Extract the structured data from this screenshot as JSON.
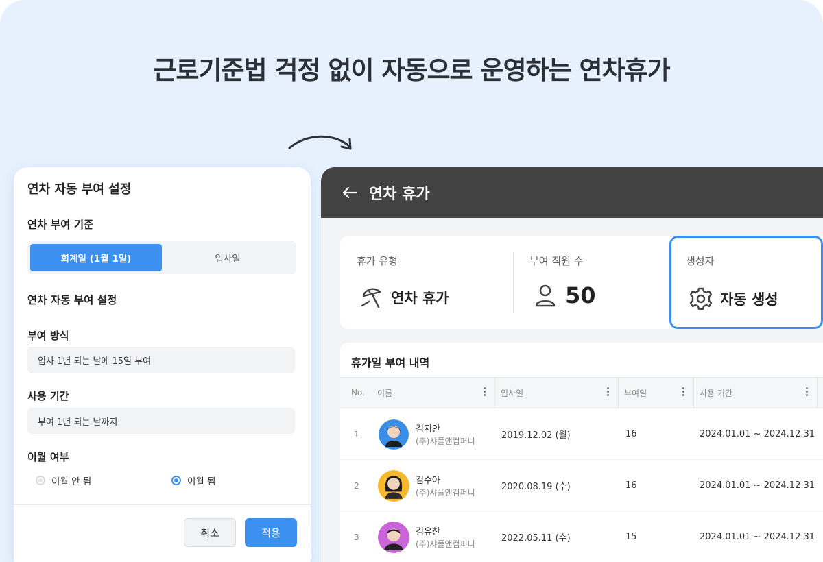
{
  "headline": "근로기준법 걱정 없이 자동으로 운영하는 연차휴가",
  "modal": {
    "title": "연차 자동 부여 설정",
    "basis_label": "연차 부여 기준",
    "basis_options": [
      "회계일 (1월 1일)",
      "입사일"
    ],
    "basis_selected": "회계일 (1월 1일)",
    "auto_label": "연차 자동 부여 설정",
    "method_label": "부여 방식",
    "method_value": "입사 1년 되는 날에 15일 부여",
    "period_label": "사용 기간",
    "period_value": "부여 1년 되는 날까지",
    "carry_label": "이월 여부",
    "carry_options": [
      "이월 안 됨",
      "이월 됨"
    ],
    "carry_selected": "이월 됨",
    "cancel_label": "취소",
    "apply_label": "적용"
  },
  "app": {
    "title": "연차 휴가",
    "info": {
      "type_label": "휴가 유형",
      "type_value": "연차 휴가",
      "count_label": "부여 직원 수",
      "count_value": "50",
      "creator_label": "생성자",
      "creator_value": "자동 생성"
    },
    "table": {
      "title": "휴가일 부여 내역",
      "headers": [
        "No.",
        "이름",
        "입사일",
        "부여일",
        "사용 기간"
      ],
      "rows": [
        {
          "no": "1",
          "name": "김지안",
          "company": "(주)샤플앤컴퍼니",
          "joined": "2019.12.02 (월)",
          "days": "16",
          "period": "2024.01.01 ~ 2024.12.31"
        },
        {
          "no": "2",
          "name": "김수아",
          "company": "(주)샤플앤컴퍼니",
          "joined": "2020.08.19 (수)",
          "days": "16",
          "period": "2024.01.01 ~ 2024.12.31"
        },
        {
          "no": "3",
          "name": "김유찬",
          "company": "(주)샤플앤컴퍼니",
          "joined": "2022.05.11 (수)",
          "days": "15",
          "period": "2024.01.01 ~ 2024.12.31"
        }
      ]
    }
  },
  "colors": {
    "accent": "#3c91f0",
    "appbar": "#434343",
    "background": "#e6f1fd",
    "avatar_1": "#3a8ee6",
    "avatar_2": "#f5b82e",
    "avatar_3": "#c964d9"
  },
  "icons": [
    "curved-arrow-icon",
    "back-arrow-icon",
    "beach-umbrella-icon",
    "person-icon",
    "gear-icon",
    "kebab-icon"
  ]
}
